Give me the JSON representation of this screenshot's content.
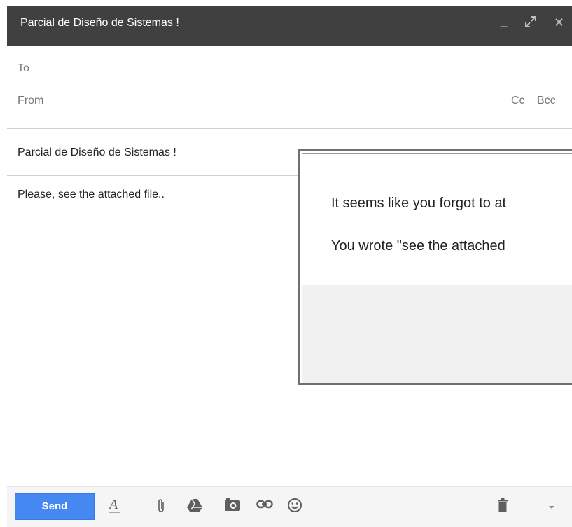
{
  "window": {
    "title": "Parcial de Diseño de Sistemas !",
    "controls": {
      "minimize": "_",
      "expand": "↗",
      "close": "✕"
    }
  },
  "compose": {
    "to_label": "To",
    "from_label": "From",
    "cc_label": "Cc",
    "bcc_label": "Bcc",
    "subject": "Parcial de Diseño de Sistemas !",
    "body": "Please, see the attached file.."
  },
  "dialog": {
    "line1": "It seems like you forgot to at",
    "line2": "You wrote \"see the attached"
  },
  "toolbar": {
    "send_label": "Send",
    "icons": [
      "format-text-icon",
      "attach-icon",
      "drive-icon",
      "photo-icon",
      "link-icon",
      "emoji-icon",
      "trash-icon",
      "more-options-icon"
    ]
  },
  "colors": {
    "titlebar": "#404040",
    "send_button": "#4688f1"
  }
}
